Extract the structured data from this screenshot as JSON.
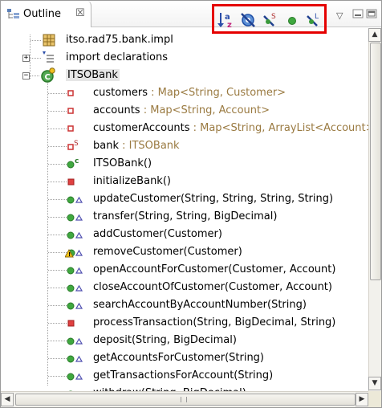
{
  "view": {
    "title": "Outline",
    "close_glyph": "☒",
    "toolbar": [
      {
        "name": "sort-alphabetically-button",
        "icon": "sort-az-icon"
      },
      {
        "name": "hide-fields-button",
        "icon": "hide-fields-icon"
      },
      {
        "name": "hide-static-members-button",
        "icon": "hide-static-icon"
      },
      {
        "name": "hide-non-public-members-button",
        "icon": "green-dot-icon"
      },
      {
        "name": "hide-local-types-button",
        "icon": "hide-local-types-icon"
      }
    ],
    "menu_glyph": "▽",
    "colors": {
      "highlight_border": "#e50000",
      "type_text": "#9a7a41",
      "public_method": "#3b9a3b",
      "private_member": "#cc3333"
    }
  },
  "tree": {
    "package": {
      "label": "itso.rad75.bank.impl",
      "icon": "package-icon"
    },
    "imports": {
      "label": "import declarations",
      "icon": "imports-icon",
      "expander": "+"
    },
    "class": {
      "label": "ITSOBank",
      "icon": "class-icon",
      "expander": "−"
    },
    "members": [
      {
        "name": "customers",
        "type": " : Map<String, Customer>",
        "icon": "private-field-icon"
      },
      {
        "name": "accounts",
        "type": " : Map<String, Account>",
        "icon": "private-field-icon"
      },
      {
        "name": "customerAccounts",
        "type": " : Map<String, ArrayList<Account>>",
        "icon": "private-field-icon"
      },
      {
        "name": "bank",
        "type": " : ITSOBank",
        "icon": "private-static-field-icon"
      },
      {
        "name": "ITSOBank()",
        "type": "",
        "icon": "constructor-icon"
      },
      {
        "name": "initializeBank()",
        "type": "",
        "icon": "private-method-icon"
      },
      {
        "name": "updateCustomer(String, String, String, String)",
        "type": "",
        "icon": "public-method-override-icon"
      },
      {
        "name": "transfer(String, String, BigDecimal)",
        "type": "",
        "icon": "public-method-override-icon"
      },
      {
        "name": "addCustomer(Customer)",
        "type": "",
        "icon": "public-method-override-icon"
      },
      {
        "name": "removeCustomer(Customer)",
        "type": "",
        "icon": "warning-method-icon"
      },
      {
        "name": "openAccountForCustomer(Customer, Account)",
        "type": "",
        "icon": "public-method-override-icon"
      },
      {
        "name": "closeAccountOfCustomer(Customer, Account)",
        "type": "",
        "icon": "public-method-override-icon"
      },
      {
        "name": "searchAccountByAccountNumber(String)",
        "type": "",
        "icon": "public-method-override-icon"
      },
      {
        "name": "processTransaction(String, BigDecimal, String)",
        "type": "",
        "icon": "private-method-icon"
      },
      {
        "name": "deposit(String, BigDecimal)",
        "type": "",
        "icon": "public-method-override-icon"
      },
      {
        "name": "getAccountsForCustomer(String)",
        "type": "",
        "icon": "public-method-override-icon"
      },
      {
        "name": "getTransactionsForAccount(String)",
        "type": "",
        "icon": "public-method-override-icon"
      },
      {
        "name": "withdraw(String, BigDecimal)",
        "type": "",
        "icon": "public-method-override-icon"
      }
    ]
  }
}
